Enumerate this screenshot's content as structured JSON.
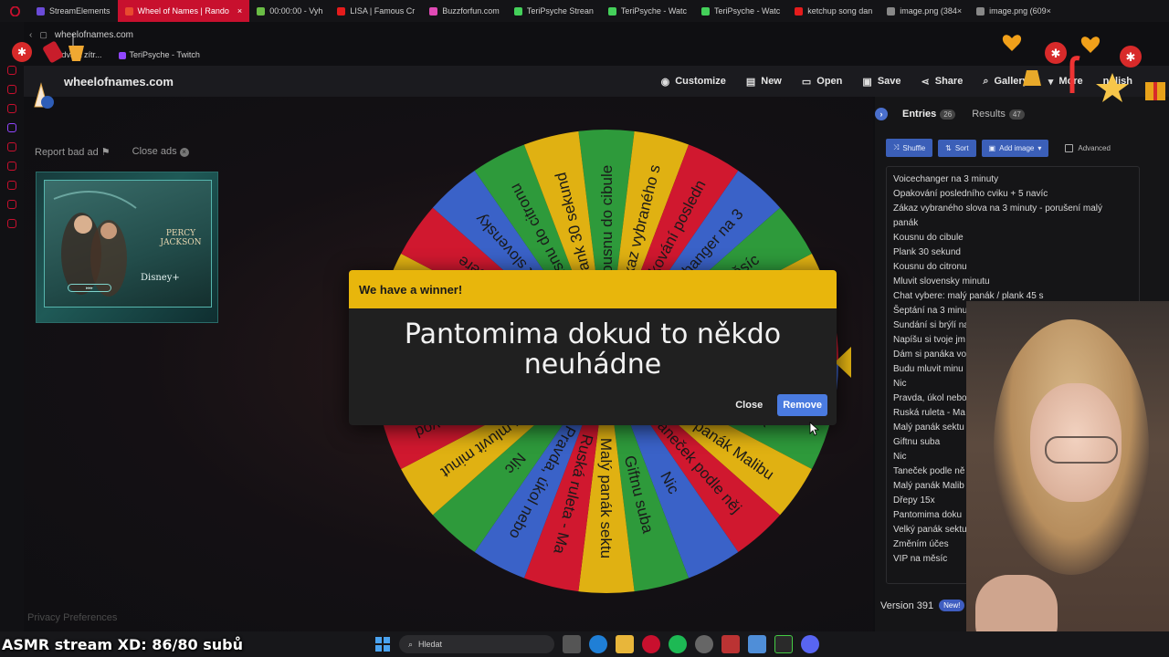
{
  "browser": {
    "tabs": [
      {
        "label": "StreamElements",
        "color": "#6b4bd8",
        "active": false
      },
      {
        "label": "Wheel of Names | Rando",
        "color": "#e84a2f",
        "active": true
      },
      {
        "label": "00:00:00 - Vyh",
        "color": "#6abd45",
        "active": false
      },
      {
        "label": "LISA | Famous Cr",
        "color": "#e51c1c",
        "active": false
      },
      {
        "label": "Buzzforfun.com",
        "color": "#e04ab5",
        "active": false
      },
      {
        "label": "TeriPsyche Strean",
        "color": "#44d05a",
        "active": false
      },
      {
        "label": "TeriPsyche - Watc",
        "color": "#44d05a",
        "active": false
      },
      {
        "label": "TeriPsyche - Watc",
        "color": "#44d05a",
        "active": false
      },
      {
        "label": "ketchup song dan",
        "color": "#e51c1c",
        "active": false
      },
      {
        "label": "image.png (384×",
        "color": "#888888",
        "active": false
      },
      {
        "label": "image.png (609×",
        "color": "#888888",
        "active": false
      }
    ],
    "address": "wheelofnames.com",
    "bookmarks": [
      "a dva a zítr...",
      "TeriPsyche - Twitch"
    ]
  },
  "site": {
    "logo": "wheelofnames.com",
    "nav": [
      {
        "label": "Customize",
        "icon": "palette-icon",
        "glyph": "◉"
      },
      {
        "label": "New",
        "icon": "file-icon",
        "glyph": "▤"
      },
      {
        "label": "Open",
        "icon": "folder-icon",
        "glyph": "▭"
      },
      {
        "label": "Save",
        "icon": "save-icon",
        "glyph": "▣"
      },
      {
        "label": "Share",
        "icon": "share-icon",
        "glyph": "⋖"
      },
      {
        "label": "Gallery",
        "icon": "search-icon",
        "glyph": "⌕"
      },
      {
        "label": "More",
        "icon": "more-icon",
        "glyph": "▾"
      },
      {
        "label": "nglish",
        "icon": "language-icon",
        "glyph": ""
      }
    ]
  },
  "ads": {
    "report_label": "Report bad ad",
    "close_label": "Close ads",
    "ad_title": "PERCY JACKSON",
    "ad_brand": "Disney+",
    "privacy": "Privacy Preferences"
  },
  "wheel": {
    "colors": [
      "#2e9a3b",
      "#e0b112",
      "#d0182f",
      "#3a62c8"
    ],
    "segments": [
      "Kousnu do cibule",
      "Zákaz vybraného s",
      "Opakování posledn",
      "Voicechanger na 3",
      "VIP na měsíc",
      "Změním účes",
      "Velký panák sektu",
      "Pantomima dokud",
      "Dřepy 15x",
      "Malý panák Malibu",
      "Taneček podle něj",
      "Nic",
      "Giftnu suba",
      "Malý panák sektu",
      "Ruská ruleta - Ma",
      "Pravda, úkol nebo",
      "Nic",
      "Budu mluvit minut",
      "Dám si panáka vod",
      "Napíšu si tvoje jm",
      "Sundání si brýlí na",
      "Šeptání na 3 minu",
      "Chat vybere",
      "Mluvit slovensky",
      "Kousnu do citronu",
      "Plank 30 sekund"
    ]
  },
  "dialog": {
    "title": "We have a winner!",
    "winner": "Pantomima dokud to někdo neuhádne",
    "close_label": "Close",
    "remove_label": "Remove"
  },
  "panel": {
    "tabs": [
      {
        "label": "Entries",
        "count": "26"
      },
      {
        "label": "Results",
        "count": "47"
      }
    ],
    "tools": {
      "shuffle": "Shuffle",
      "sort": "Sort",
      "add_image": "Add image",
      "advanced": "Advanced"
    },
    "entries": [
      "Voicechanger na 3 minuty",
      "Opakování posledního cviku + 5 navíc",
      "Zákaz vybraného slova na 3 minuty - porušení malý",
      "panák",
      "Kousnu do cibule",
      "Plank 30 sekund",
      "Kousnu do citronu",
      "Mluvit slovensky minutu",
      "Chat vybere: malý panák / plank 45 s",
      "Šeptání na 3 minu",
      "Sundání si brýlí na",
      "Napíšu si tvoje jm",
      "Dám si panáka vo",
      "Budu mluvit minu",
      "Nic",
      "Pravda, úkol nebo",
      "Ruská ruleta - Ma",
      "Malý panák sektu",
      "Giftnu suba",
      "Nic",
      "Taneček podle ně",
      "Malý panák Malib",
      "Dřepy 15x",
      "Pantomima doku",
      "Velký panák sektu",
      "Změním účes",
      "VIP na měsíc"
    ],
    "version": "Version 391",
    "new_badge": "New!"
  },
  "taskbar": {
    "search_placeholder": "Hledat",
    "overlay": "ASMR stream XD: 86/80 subů"
  }
}
